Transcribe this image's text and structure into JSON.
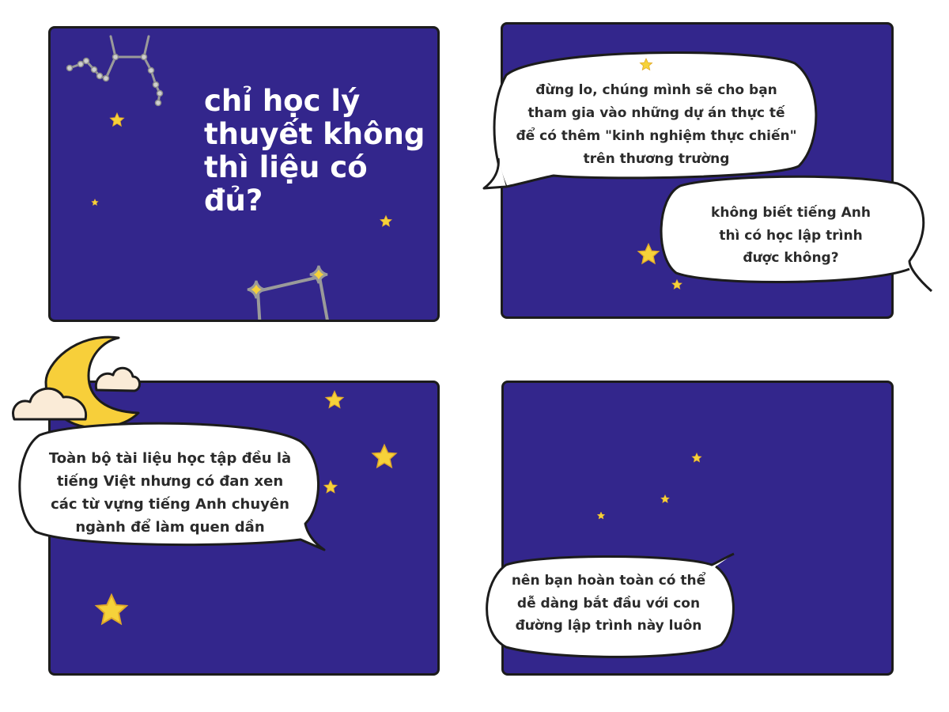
{
  "panels": {
    "panel1": {
      "headline": [
        "chỉ học lý",
        "thuyết không",
        "thì liệu có đủ?"
      ]
    },
    "panel2": {
      "bubble_top": [
        "đừng lo, chúng mình sẽ cho bạn",
        "tham gia vào những dự án thực tế",
        "để có thêm \"kinh nghiệm thực chiến\"",
        "trên thương trường"
      ],
      "bubble_bottom": [
        "không biết tiếng Anh",
        "thì có học lập trình",
        "được không?"
      ]
    },
    "panel3": {
      "bubble": [
        "Toàn bộ tài liệu học tập đều là",
        "tiếng Việt nhưng có đan xen",
        "các từ vựng tiếng Anh chuyên",
        "ngành để làm quen dần"
      ]
    },
    "panel4": {
      "bubble": [
        "nên bạn hoàn toàn có thể",
        "dễ dàng bắt đầu với con",
        "đường lập trình này luôn"
      ]
    }
  },
  "colors": {
    "panel_bg": "#33268c",
    "star": "#f6d23a",
    "moon": "#f7cf3a",
    "cloud": "#faebd7",
    "bubble": "#ffffff",
    "outline": "#1c1c1c",
    "constellation": "#9a9a9a"
  },
  "icons": [
    "star-icon",
    "moon-icon",
    "cloud-icon",
    "constellation-icon",
    "speech-bubble"
  ]
}
